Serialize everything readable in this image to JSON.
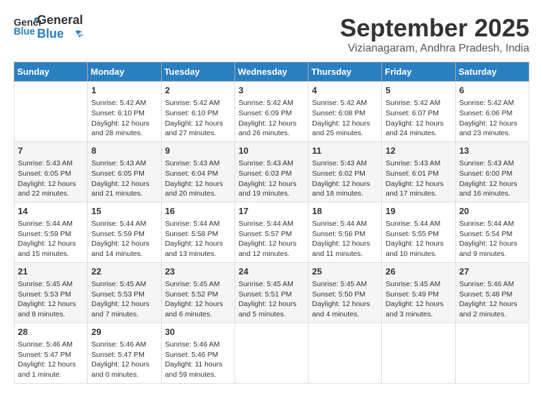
{
  "header": {
    "logo_general": "General",
    "logo_blue": "Blue",
    "month": "September 2025",
    "location": "Vizianagaram, Andhra Pradesh, India"
  },
  "columns": [
    "Sunday",
    "Monday",
    "Tuesday",
    "Wednesday",
    "Thursday",
    "Friday",
    "Saturday"
  ],
  "weeks": [
    [
      {
        "day": "",
        "info": ""
      },
      {
        "day": "1",
        "info": "Sunrise: 5:42 AM\nSunset: 6:10 PM\nDaylight: 12 hours\nand 28 minutes."
      },
      {
        "day": "2",
        "info": "Sunrise: 5:42 AM\nSunset: 6:10 PM\nDaylight: 12 hours\nand 27 minutes."
      },
      {
        "day": "3",
        "info": "Sunrise: 5:42 AM\nSunset: 6:09 PM\nDaylight: 12 hours\nand 26 minutes."
      },
      {
        "day": "4",
        "info": "Sunrise: 5:42 AM\nSunset: 6:08 PM\nDaylight: 12 hours\nand 25 minutes."
      },
      {
        "day": "5",
        "info": "Sunrise: 5:42 AM\nSunset: 6:07 PM\nDaylight: 12 hours\nand 24 minutes."
      },
      {
        "day": "6",
        "info": "Sunrise: 5:42 AM\nSunset: 6:06 PM\nDaylight: 12 hours\nand 23 minutes."
      }
    ],
    [
      {
        "day": "7",
        "info": "Sunrise: 5:43 AM\nSunset: 6:05 PM\nDaylight: 12 hours\nand 22 minutes."
      },
      {
        "day": "8",
        "info": "Sunrise: 5:43 AM\nSunset: 6:05 PM\nDaylight: 12 hours\nand 21 minutes."
      },
      {
        "day": "9",
        "info": "Sunrise: 5:43 AM\nSunset: 6:04 PM\nDaylight: 12 hours\nand 20 minutes."
      },
      {
        "day": "10",
        "info": "Sunrise: 5:43 AM\nSunset: 6:03 PM\nDaylight: 12 hours\nand 19 minutes."
      },
      {
        "day": "11",
        "info": "Sunrise: 5:43 AM\nSunset: 6:02 PM\nDaylight: 12 hours\nand 18 minutes."
      },
      {
        "day": "12",
        "info": "Sunrise: 5:43 AM\nSunset: 6:01 PM\nDaylight: 12 hours\nand 17 minutes."
      },
      {
        "day": "13",
        "info": "Sunrise: 5:43 AM\nSunset: 6:00 PM\nDaylight: 12 hours\nand 16 minutes."
      }
    ],
    [
      {
        "day": "14",
        "info": "Sunrise: 5:44 AM\nSunset: 5:59 PM\nDaylight: 12 hours\nand 15 minutes."
      },
      {
        "day": "15",
        "info": "Sunrise: 5:44 AM\nSunset: 5:59 PM\nDaylight: 12 hours\nand 14 minutes."
      },
      {
        "day": "16",
        "info": "Sunrise: 5:44 AM\nSunset: 5:58 PM\nDaylight: 12 hours\nand 13 minutes."
      },
      {
        "day": "17",
        "info": "Sunrise: 5:44 AM\nSunset: 5:57 PM\nDaylight: 12 hours\nand 12 minutes."
      },
      {
        "day": "18",
        "info": "Sunrise: 5:44 AM\nSunset: 5:56 PM\nDaylight: 12 hours\nand 11 minutes."
      },
      {
        "day": "19",
        "info": "Sunrise: 5:44 AM\nSunset: 5:55 PM\nDaylight: 12 hours\nand 10 minutes."
      },
      {
        "day": "20",
        "info": "Sunrise: 5:44 AM\nSunset: 5:54 PM\nDaylight: 12 hours\nand 9 minutes."
      }
    ],
    [
      {
        "day": "21",
        "info": "Sunrise: 5:45 AM\nSunset: 5:53 PM\nDaylight: 12 hours\nand 8 minutes."
      },
      {
        "day": "22",
        "info": "Sunrise: 5:45 AM\nSunset: 5:53 PM\nDaylight: 12 hours\nand 7 minutes."
      },
      {
        "day": "23",
        "info": "Sunrise: 5:45 AM\nSunset: 5:52 PM\nDaylight: 12 hours\nand 6 minutes."
      },
      {
        "day": "24",
        "info": "Sunrise: 5:45 AM\nSunset: 5:51 PM\nDaylight: 12 hours\nand 5 minutes."
      },
      {
        "day": "25",
        "info": "Sunrise: 5:45 AM\nSunset: 5:50 PM\nDaylight: 12 hours\nand 4 minutes."
      },
      {
        "day": "26",
        "info": "Sunrise: 5:45 AM\nSunset: 5:49 PM\nDaylight: 12 hours\nand 3 minutes."
      },
      {
        "day": "27",
        "info": "Sunrise: 5:46 AM\nSunset: 5:48 PM\nDaylight: 12 hours\nand 2 minutes."
      }
    ],
    [
      {
        "day": "28",
        "info": "Sunrise: 5:46 AM\nSunset: 5:47 PM\nDaylight: 12 hours\nand 1 minute."
      },
      {
        "day": "29",
        "info": "Sunrise: 5:46 AM\nSunset: 5:47 PM\nDaylight: 12 hours\nand 0 minutes."
      },
      {
        "day": "30",
        "info": "Sunrise: 5:46 AM\nSunset: 5:46 PM\nDaylight: 11 hours\nand 59 minutes."
      },
      {
        "day": "",
        "info": ""
      },
      {
        "day": "",
        "info": ""
      },
      {
        "day": "",
        "info": ""
      },
      {
        "day": "",
        "info": ""
      }
    ]
  ]
}
